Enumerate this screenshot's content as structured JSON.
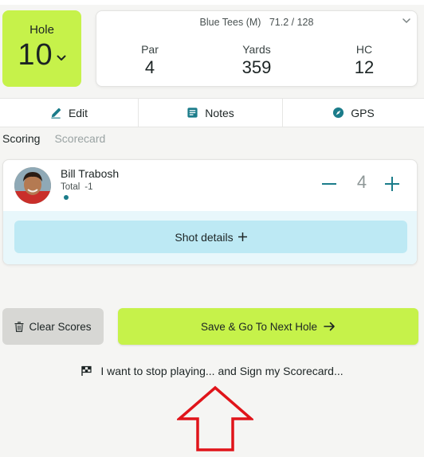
{
  "hole": {
    "label": "Hole",
    "number": "10"
  },
  "tee": {
    "info": "Blue Tees (M)   71.2 / 128",
    "stats": [
      {
        "label": "Par",
        "value": "4"
      },
      {
        "label": "Yards",
        "value": "359"
      },
      {
        "label": "HC",
        "value": "12"
      }
    ]
  },
  "actions": {
    "edit": "Edit",
    "notes": "Notes",
    "gps": "GPS"
  },
  "tabs": {
    "scoring": "Scoring",
    "scorecard": "Scorecard"
  },
  "player": {
    "name": "Bill Trabosh",
    "total_label": "Total",
    "total_value": "-1",
    "score": "4"
  },
  "shot_details": {
    "label": "Shot details",
    "icon": "plus-icon"
  },
  "buttons": {
    "clear": "Clear Scores",
    "save": "Save & Go To Next Hole",
    "stop": "I want to stop playing... and Sign my Scorecard..."
  },
  "colors": {
    "accent_lime": "#c6f24a",
    "shot_button": "#bde9f4",
    "shot_panel": "#e8f7fb",
    "teal": "#1b7c8a",
    "annotation_red": "#e0141a"
  }
}
